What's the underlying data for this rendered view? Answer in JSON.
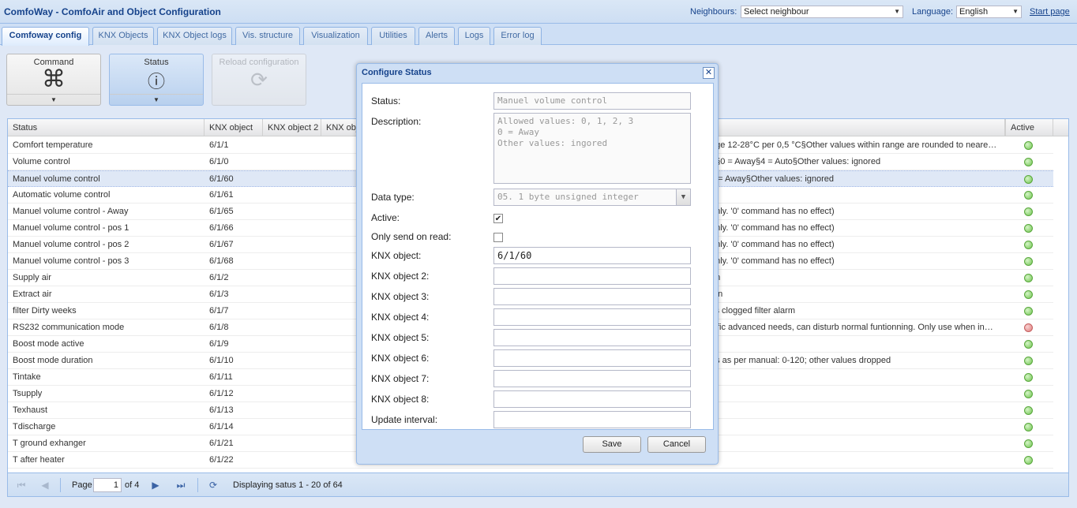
{
  "header": {
    "title": "ComfoWay - ComfoAir and Object Configuration",
    "neighbours_label": "Neighbours:",
    "neighbours_value": "Select neighbour",
    "language_label": "Language:",
    "language_value": "English",
    "start_page": "Start page"
  },
  "tabs": [
    {
      "label": "Comfoway config"
    },
    {
      "label": "KNX Objects"
    },
    {
      "label": "KNX Object logs"
    },
    {
      "label": "Vis. structure"
    },
    {
      "label": "Visualization"
    },
    {
      "label": "Utilities"
    },
    {
      "label": "Alerts"
    },
    {
      "label": "Logs"
    },
    {
      "label": "Error log"
    }
  ],
  "toolbar": {
    "command": "Command",
    "status": "Status",
    "reload": "Reload configuration"
  },
  "grid": {
    "columns": {
      "status": "Status",
      "knx1": "KNX object",
      "knx2": "KNX object 2",
      "knx3": "KNX obj",
      "active": "Active"
    },
    "rows": [
      {
        "status": "Comfort temperature",
        "knx": "6/1/1",
        "desc": "nge 12-28°C per 0,5 °C§Other values within range are rounded to neare…",
        "active": true
      },
      {
        "status": "Volume control",
        "knx": "6/1/0",
        "desc": "4§0 = Away§4 = Auto§Other values: ignored",
        "active": true
      },
      {
        "status": "Manuel volume control",
        "knx": "6/1/60",
        "desc": "0 = Away§Other values: ignored",
        "active": true
      },
      {
        "status": "Automatic volume control",
        "knx": "6/1/61",
        "desc": "",
        "active": true
      },
      {
        "status": "Manuel volume control - Away",
        "knx": "6/1/65",
        "desc": "only. '0' command has no effect)",
        "active": true
      },
      {
        "status": "Manuel volume control - pos 1",
        "knx": "6/1/66",
        "desc": "only. '0' command has no effect)",
        "active": true
      },
      {
        "status": "Manuel volume control - pos 2",
        "knx": "6/1/67",
        "desc": "only. '0' command has no effect)",
        "active": true
      },
      {
        "status": "Manuel volume control - pos 3",
        "knx": "6/1/68",
        "desc": "only. '0' command has no effect)",
        "active": true
      },
      {
        "status": "Supply air",
        "knx": "6/1/2",
        "desc": "an",
        "active": true
      },
      {
        "status": "Extract air",
        "knx": "6/1/3",
        "desc": "fan",
        "active": true
      },
      {
        "status": "filter Dirty weeks",
        "knx": "6/1/7",
        "desc": "ks clogged filter alarm",
        "active": true
      },
      {
        "status": "RS232 communication mode",
        "knx": "6/1/8",
        "desc": "cific advanced needs, can disturb normal funtionning. Only use when in…",
        "active": false
      },
      {
        "status": "Boost mode active",
        "knx": "6/1/9",
        "desc": "",
        "active": true
      },
      {
        "status": "Boost mode duration",
        "knx": "6/1/10",
        "desc": "es as per manual: 0-120; other values dropped",
        "active": true
      },
      {
        "status": "Tintake",
        "knx": "6/1/11",
        "desc": "",
        "active": true
      },
      {
        "status": "Tsupply",
        "knx": "6/1/12",
        "desc": "",
        "active": true
      },
      {
        "status": "Texhaust",
        "knx": "6/1/13",
        "desc": "",
        "active": true
      },
      {
        "status": "Tdischarge",
        "knx": "6/1/14",
        "desc": "",
        "active": true
      },
      {
        "status": "T ground exhanger",
        "knx": "6/1/21",
        "desc": "",
        "active": true
      },
      {
        "status": "T after heater",
        "knx": "6/1/22",
        "desc": "",
        "active": true
      }
    ]
  },
  "paging": {
    "page_label": "Page",
    "page_value": "1",
    "of_label": "of 4",
    "display": "Displaying satus 1 - 20 of 64"
  },
  "modal": {
    "title": "Configure Status",
    "close": "✕",
    "status_label": "Status:",
    "status_value": "Manuel volume control",
    "description_label": "Description:",
    "description_value": "Allowed values: 0, 1, 2, 3\n0 = Away\nOther values: ingored",
    "datatype_label": "Data type:",
    "datatype_value": "05. 1 byte unsigned integer",
    "active_label": "Active:",
    "only_send_label": "Only send on read:",
    "knx1_label": "KNX object:",
    "knx1_value": "6/1/60",
    "knx2_label": "KNX object 2:",
    "knx3_label": "KNX object 3:",
    "knx4_label": "KNX object 4:",
    "knx5_label": "KNX object 5:",
    "knx6_label": "KNX object 6:",
    "knx7_label": "KNX object 7:",
    "knx8_label": "KNX object 8:",
    "update_label": "Update interval:",
    "save": "Save",
    "cancel": "Cancel"
  }
}
